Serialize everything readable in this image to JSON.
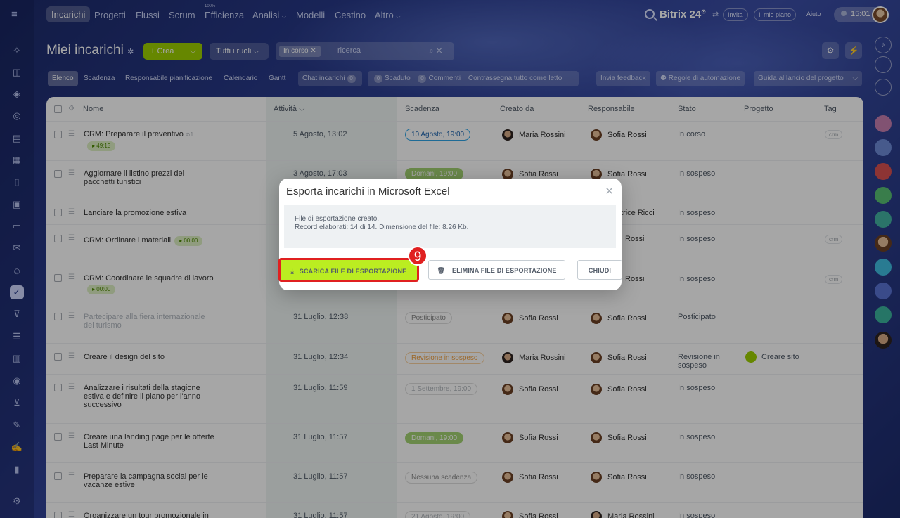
{
  "topnav": {
    "items": [
      "Incarichi",
      "Progetti",
      "Flussi",
      "Scrum",
      "Efficienza",
      "Analisi",
      "Modelli",
      "Cestino",
      "Altro"
    ],
    "efficienza_badge": "100%",
    "brand": "Bitrix 24",
    "invita": "Invita",
    "mio_piano": "Il mio piano",
    "aiuto": "Aiuto",
    "clock": "15:01"
  },
  "header": {
    "title": "Miei incarichi",
    "crea": "Crea",
    "ruoli": "Tutti i ruoli",
    "filter_chip": "In corso",
    "search_placeholder": "ricerca"
  },
  "subnav": {
    "elenco": "Elenco",
    "scadenza": "Scadenza",
    "responsabile": "Responsabile pianificazione",
    "calendario": "Calendario",
    "gantt": "Gantt",
    "chat": "Chat incarichi",
    "chat_count": "0",
    "scaduto_count": "0",
    "scaduto": "Scaduto",
    "commenti_count": "0",
    "commenti": "Commenti",
    "contrassegna": "Contrassegna tutto come letto",
    "feedback": "Invia feedback",
    "regole": "Regole di automazione",
    "guida": "Guida al lancio del progetto"
  },
  "table": {
    "headers": {
      "nome": "Nome",
      "attivita": "Attività",
      "scadenza": "Scadenza",
      "creato": "Creato da",
      "responsabile": "Responsabile",
      "stato": "Stato",
      "progetto": "Progetto",
      "tag": "Tag"
    },
    "rows": [
      {
        "name": "CRM: Preparare il preventivo",
        "subcount": "1",
        "timer": "49:13",
        "activity": "5 Agosto, 13:02",
        "deadline": "10 Agosto, 19:00",
        "creator": "Maria Rossini",
        "resp": "Sofia Rossi",
        "status": "In corso",
        "tag": "crm"
      },
      {
        "name": "Aggiornare il listino prezzi dei pacchetti turistici",
        "activity": "3 Agosto, 17:03",
        "deadline": "Domani, 19:00",
        "creator": "Sofia Rossi",
        "resp": "Sofia Rossi",
        "status": "In sospeso"
      },
      {
        "name": "Lanciare la promozione estiva",
        "resp": "trice Ricci",
        "status": "In sospeso"
      },
      {
        "name": "CRM: Ordinare i materiali",
        "timer": "00:00",
        "resp": "Rossi",
        "status": "In sospeso",
        "tag": "crm"
      },
      {
        "name": "CRM: Coordinare le squadre di lavoro",
        "timer": "00:00",
        "resp": "Rossi",
        "status": "In sospeso",
        "tag": "crm"
      },
      {
        "name": "Partecipare alla fiera internazionale del turismo",
        "activity": "31 Luglio, 12:38",
        "deadline": "Posticipato",
        "creator": "Sofia Rossi",
        "resp": "Sofia Rossi",
        "status": "Posticipato"
      },
      {
        "name": "Creare il design del sito",
        "activity": "31 Luglio, 12:34",
        "deadline": "Revisione in sospeso",
        "creator": "Maria Rossini",
        "resp": "Sofia Rossi",
        "status": "Revisione in sospeso",
        "project": "Creare sito"
      },
      {
        "name": "Analizzare i risultati della stagione estiva e definire il piano per l'anno successivo",
        "activity": "31 Luglio, 11:59",
        "deadline": "1 Settembre, 19:00",
        "creator": "Sofia Rossi",
        "resp": "Sofia Rossi",
        "status": "In sospeso"
      },
      {
        "name": "Creare una landing page per le offerte Last Minute",
        "activity": "31 Luglio, 11:57",
        "deadline": "Domani, 19:00",
        "creator": "Sofia Rossi",
        "resp": "Sofia Rossi",
        "status": "In sospeso"
      },
      {
        "name": "Preparare la campagna social per le vacanze estive",
        "activity": "31 Luglio, 11:57",
        "deadline": "Nessuna scadenza",
        "creator": "Sofia Rossi",
        "resp": "Sofia Rossi",
        "status": "In sospeso"
      },
      {
        "name": "Organizzare un tour promozionale in",
        "activity": "31 Luglio, 11:57",
        "deadline": "21 Agosto, 19:00",
        "creator": "Sofia Rossi",
        "resp": "Maria Rossini",
        "status": "In sospeso"
      }
    ]
  },
  "modal": {
    "title": "Esporta incarichi in Microsoft Excel",
    "line1": "File di esportazione creato.",
    "line2": "Record elaborati: 14 di 14. Dimensione del file: 8.26 Kb.",
    "download": "SCARICA FILE DI ESPORTAZIONE",
    "delete": "ELIMINA FILE DI ESPORTAZIONE",
    "close": "CHIUDI"
  },
  "step_badge": "9",
  "colors": {
    "accent_green": "#bbed21",
    "highlight_red": "#e02020",
    "bg_blue": "#2a3c8e"
  }
}
